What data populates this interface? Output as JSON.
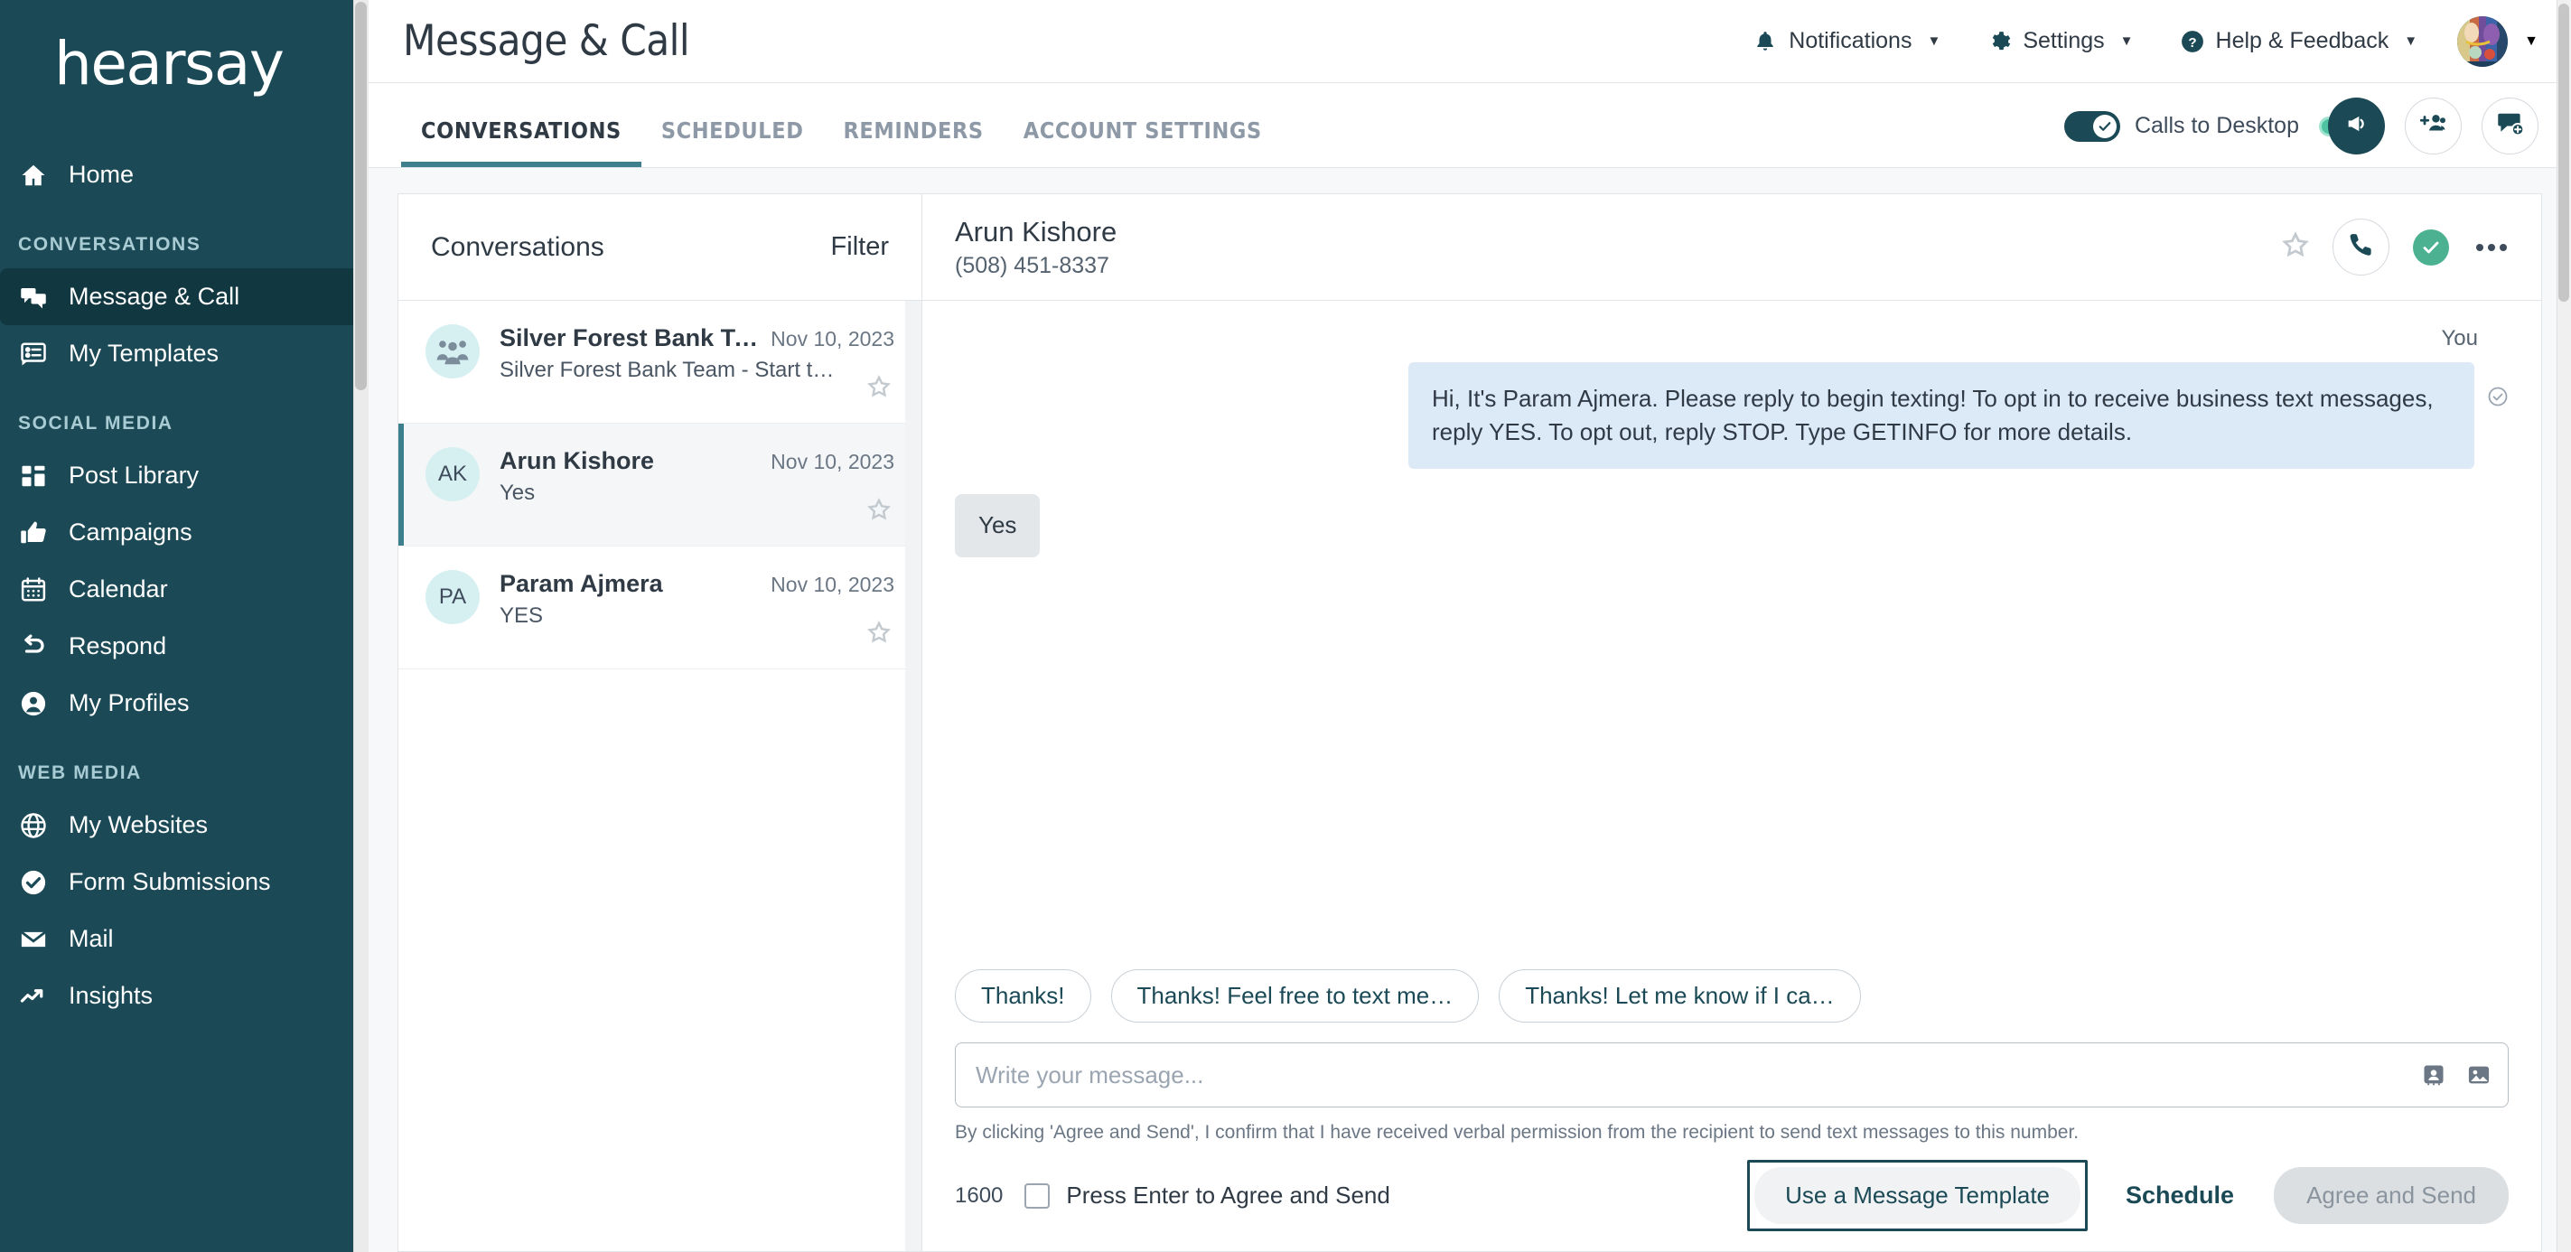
{
  "sidebar": {
    "brand": "hearsay",
    "top_items": [
      {
        "label": "Home",
        "icon": "home-icon"
      }
    ],
    "sections": [
      {
        "label": "CONVERSATIONS",
        "items": [
          {
            "label": "Message & Call",
            "icon": "chat-bubbles-icon",
            "active": true
          },
          {
            "label": "My Templates",
            "icon": "template-list-icon",
            "active": false
          }
        ]
      },
      {
        "label": "SOCIAL MEDIA",
        "items": [
          {
            "label": "Post Library",
            "icon": "grid-blocks-icon",
            "active": false
          },
          {
            "label": "Campaigns",
            "icon": "thumbs-up-icon",
            "active": false
          },
          {
            "label": "Calendar",
            "icon": "calendar-icon",
            "active": false
          },
          {
            "label": "Respond",
            "icon": "reply-arrow-icon",
            "active": false
          },
          {
            "label": "My Profiles",
            "icon": "user-circle-icon",
            "active": false
          }
        ]
      },
      {
        "label": "WEB MEDIA",
        "items": [
          {
            "label": "My Websites",
            "icon": "globe-icon",
            "active": false
          },
          {
            "label": "Form Submissions",
            "icon": "check-circle-icon",
            "active": false
          },
          {
            "label": "Mail",
            "icon": "envelope-icon",
            "active": false
          },
          {
            "label": "Insights",
            "icon": "trend-up-icon",
            "active": false
          }
        ]
      }
    ]
  },
  "header": {
    "title": "Message & Call",
    "menus": [
      {
        "label": "Notifications",
        "icon": "bell-icon"
      },
      {
        "label": "Settings",
        "icon": "gear-icon"
      },
      {
        "label": "Help & Feedback",
        "icon": "help-circle-icon"
      }
    ]
  },
  "tabs": [
    {
      "label": "CONVERSATIONS",
      "active": true
    },
    {
      "label": "SCHEDULED",
      "active": false
    },
    {
      "label": "REMINDERS",
      "active": false
    },
    {
      "label": "ACCOUNT SETTINGS",
      "active": false
    }
  ],
  "tabbar_controls": {
    "calls_to_desktop_label": "Calls to Desktop",
    "calls_to_desktop_on": true,
    "status_dot": "online-status-dot",
    "buttons": [
      {
        "icon": "megaphone-icon",
        "style": "filled"
      },
      {
        "icon": "add-contact-icon",
        "style": "outlined"
      },
      {
        "icon": "new-message-icon",
        "style": "outlined"
      }
    ]
  },
  "conversations_panel": {
    "title": "Conversations",
    "filter_label": "Filter",
    "items": [
      {
        "avatar_type": "group",
        "initials": "",
        "name": "Silver Forest Bank Te…",
        "date": "Nov 10, 2023",
        "preview": "Silver Forest Bank Team - Start typi…",
        "selected": false
      },
      {
        "avatar_type": "initials",
        "initials": "AK",
        "name": "Arun Kishore",
        "date": "Nov 10, 2023",
        "preview": "Yes",
        "selected": true
      },
      {
        "avatar_type": "initials",
        "initials": "PA",
        "name": "Param Ajmera",
        "date": "Nov 10, 2023",
        "preview": "YES",
        "selected": false
      }
    ]
  },
  "thread": {
    "contact_name": "Arun Kishore",
    "phone": "(508) 451-8337",
    "you_label": "You",
    "messages": [
      {
        "direction": "outgoing",
        "text": "Hi, It's Param Ajmera. Please reply to begin texting! To opt in to receive business text messages, reply YES. To opt out, reply STOP. Type GETINFO for more details."
      },
      {
        "direction": "incoming",
        "text": "Yes"
      }
    ],
    "quick_replies": [
      "Thanks!",
      "Thanks! Feel free to text me…",
      "Thanks! Let me know if I ca…"
    ],
    "composer": {
      "placeholder": "Write your message...",
      "value": "",
      "icons": [
        {
          "icon": "contact-card-icon"
        },
        {
          "icon": "image-icon"
        }
      ]
    },
    "disclaimer": "By clicking 'Agree and Send', I confirm that I have received verbal permission from the recipient to send text messages to this number.",
    "char_count": "1600",
    "press_enter_label": "Press Enter to Agree and Send",
    "press_enter_checked": false,
    "buttons": {
      "template": "Use a Message Template",
      "schedule": "Schedule",
      "send": "Agree and Send",
      "send_disabled": true
    }
  },
  "colors": {
    "sidebar_bg": "#1b4a56",
    "sidebar_active": "#113740",
    "accent_teal": "#3d7f8d",
    "bubble_out": "#dce9f7",
    "bubble_in": "#e3e7ea",
    "status_green": "#4bb191",
    "avatar_bg": "#d6f0f2"
  }
}
